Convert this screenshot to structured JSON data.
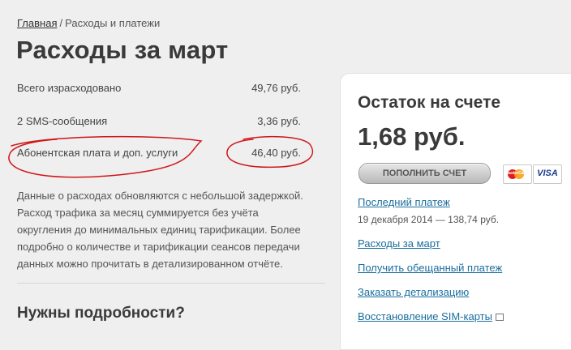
{
  "breadcrumb": {
    "home": "Главная",
    "separator": "/",
    "current": "Расходы и платежи"
  },
  "title": "Расходы за март",
  "expenses": [
    {
      "label": "Всего израсходовано",
      "value": "49,76 руб."
    },
    {
      "label": "2 SMS-сообщения",
      "value": "3,36 руб."
    },
    {
      "label": "Абонентская плата и доп. услуги",
      "value": "46,40 руб."
    }
  ],
  "note": "Данные о расходах обновляются с небольшой задержкой. Расход трафика за месяц суммируется без учёта округления до минимальных единиц тарификации. Более подробно о количестве и тарификации сеансов передачи данных можно прочитать в детализированном отчёте.",
  "details_heading": "Нужны подробности?",
  "balance_panel": {
    "title": "Остаток на счете",
    "amount": "1,68 руб.",
    "topup_button": "ПОПОЛНИТЬ СЧЕТ",
    "card_logos": {
      "mastercard": "MasterCard",
      "visa": "VISA"
    },
    "last_payment_link": "Последний платеж",
    "last_payment_info": "19 декабря 2014 — 138,74 руб.",
    "links": [
      "Расходы за март",
      "Получить обещанный платеж",
      "Заказать детализацию",
      "Восстановление SIM-карты"
    ]
  },
  "colors": {
    "link": "#1a6e9e",
    "annotation": "#d0161a",
    "panel_bg": "#ffffff",
    "page_bg": "#efefef"
  }
}
